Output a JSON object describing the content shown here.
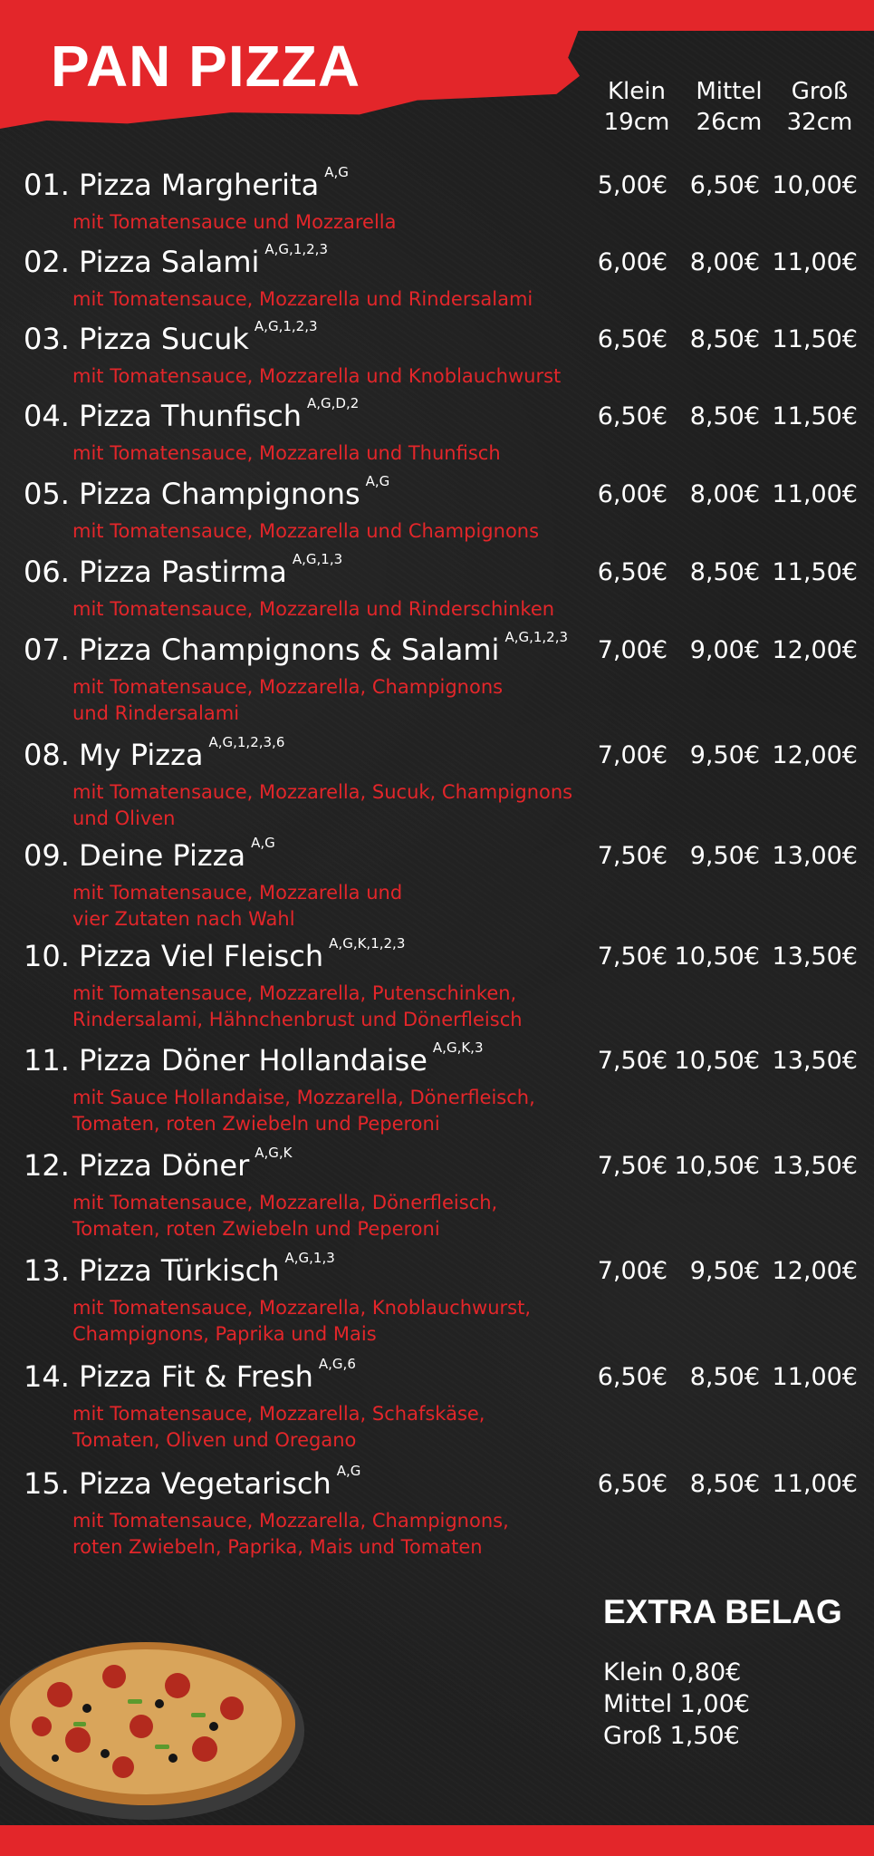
{
  "title": "PAN PIZZA",
  "sizes": [
    {
      "name": "Klein",
      "diameter": "19cm"
    },
    {
      "name": "Mittel",
      "diameter": "26cm"
    },
    {
      "name": "Groß",
      "diameter": "32cm"
    }
  ],
  "items": [
    {
      "name": "01. Pizza Margherita",
      "allergens": "A,G",
      "desc": "mit Tomatensauce und Mozzarella",
      "prices": [
        "5,00€",
        "6,50€",
        "10,00€"
      ]
    },
    {
      "name": "02. Pizza Salami",
      "allergens": "A,G,1,2,3",
      "desc": "mit Tomatensauce, Mozzarella und Rindersalami",
      "prices": [
        "6,00€",
        "8,00€",
        "11,00€"
      ]
    },
    {
      "name": "03. Pizza Sucuk",
      "allergens": "A,G,1,2,3",
      "desc": "mit Tomatensauce, Mozzarella und Knoblauchwurst",
      "prices": [
        "6,50€",
        "8,50€",
        "11,50€"
      ]
    },
    {
      "name": "04. Pizza Thunfisch",
      "allergens": "A,G,D,2",
      "desc": "mit Tomatensauce, Mozzarella und Thunfisch",
      "prices": [
        "6,50€",
        "8,50€",
        "11,50€"
      ]
    },
    {
      "name": "05. Pizza Champignons",
      "allergens": "A,G",
      "desc": "mit Tomatensauce, Mozzarella und Champignons",
      "prices": [
        "6,00€",
        "8,00€",
        "11,00€"
      ]
    },
    {
      "name": "06. Pizza Pastirma",
      "allergens": "A,G,1,3",
      "desc": "mit Tomatensauce, Mozzarella und Rinderschinken",
      "prices": [
        "6,50€",
        "8,50€",
        "11,50€"
      ]
    },
    {
      "name": "07. Pizza Champignons & Salami",
      "allergens": "A,G,1,2,3",
      "desc": "mit Tomatensauce, Mozzarella, Champignons\nund Rindersalami",
      "prices": [
        "7,00€",
        "9,00€",
        "12,00€"
      ]
    },
    {
      "name": "08. My Pizza",
      "allergens": "A,G,1,2,3,6",
      "desc": "mit Tomatensauce, Mozzarella, Sucuk, Champignons\nund Oliven",
      "prices": [
        "7,00€",
        "9,50€",
        "12,00€"
      ]
    },
    {
      "name": "09. Deine Pizza",
      "allergens": "A,G",
      "desc": "mit Tomatensauce, Mozzarella und\nvier Zutaten nach Wahl",
      "prices": [
        "7,50€",
        "9,50€",
        "13,00€"
      ]
    },
    {
      "name": "10. Pizza Viel Fleisch",
      "allergens": "A,G,K,1,2,3",
      "desc": "mit Tomatensauce, Mozzarella, Putenschinken,\nRindersalami, Hähnchenbrust und Dönerfleisch",
      "prices": [
        "7,50€",
        "10,50€",
        "13,50€"
      ]
    },
    {
      "name": "11. Pizza Döner Hollandaise",
      "allergens": "A,G,K,3",
      "desc": "mit Sauce Hollandaise, Mozzarella, Dönerfleisch,\nTomaten, roten Zwiebeln und Peperoni",
      "prices": [
        "7,50€",
        "10,50€",
        "13,50€"
      ]
    },
    {
      "name": "12. Pizza Döner",
      "allergens": "A,G,K",
      "desc": "mit Tomatensauce, Mozzarella, Dönerfleisch,\nTomaten, roten Zwiebeln und Peperoni",
      "prices": [
        "7,50€",
        "10,50€",
        "13,50€"
      ]
    },
    {
      "name": "13. Pizza Türkisch",
      "allergens": "A,G,1,3",
      "desc": "mit Tomatensauce, Mozzarella, Knoblauchwurst,\nChampignons, Paprika und Mais",
      "prices": [
        "7,00€",
        "9,50€",
        "12,00€"
      ]
    },
    {
      "name": "14. Pizza Fit & Fresh",
      "allergens": "A,G,6",
      "desc": "mit Tomatensauce, Mozzarella, Schafskäse,\nTomaten, Oliven und Oregano",
      "prices": [
        "6,50€",
        "8,50€",
        "11,00€"
      ]
    },
    {
      "name": "15. Pizza Vegetarisch",
      "allergens": "A,G",
      "desc": "mit Tomatensauce, Mozzarella, Champignons,\nroten Zwiebeln, Paprika, Mais und Tomaten",
      "prices": [
        "6,50€",
        "8,50€",
        "11,00€"
      ]
    }
  ],
  "extra": {
    "title": "EXTRA BELAG",
    "lines": [
      "Klein 0,80€",
      "Mittel 1,00€",
      "Groß 1,50€"
    ]
  },
  "colors": {
    "accent": "#e3262a",
    "background": "#1f1f1f",
    "text": "#ffffff"
  },
  "icons": {
    "pizza": "pizza-photo"
  }
}
